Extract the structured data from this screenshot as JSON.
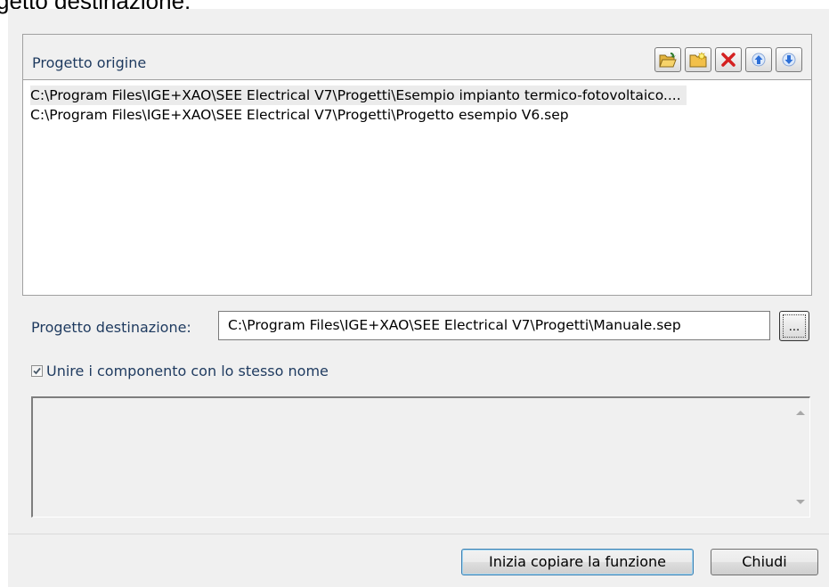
{
  "caption_fragment": "getto destinazione:",
  "source": {
    "title": "Progetto origine",
    "toolbar": [
      {
        "name": "open-folder-icon",
        "label": "open"
      },
      {
        "name": "new-folder-icon",
        "label": "add"
      },
      {
        "name": "delete-icon",
        "label": "delete"
      },
      {
        "name": "move-up-icon",
        "label": "up"
      },
      {
        "name": "move-down-icon",
        "label": "down"
      }
    ],
    "items": [
      "C:\\Program Files\\IGE+XAO\\SEE Electrical V7\\Progetti\\Esempio impianto termico-fotovoltaico....",
      "C:\\Program Files\\IGE+XAO\\SEE Electrical V7\\Progetti\\Progetto esempio V6.sep"
    ],
    "selected_index": 0
  },
  "destination": {
    "label": "Progetto destinazione:",
    "value": "C:\\Program Files\\IGE+XAO\\SEE Electrical V7\\Progetti\\Manuale.sep",
    "browse_label": "..."
  },
  "merge": {
    "label": "Unire i componento con lo stesso nome",
    "checked": true
  },
  "buttons": {
    "start": "Inizia copiare la funzione",
    "close": "Chiudi"
  },
  "colors": {
    "dialog_bg": "#f0f0f0",
    "label_text": "#1e3a5f",
    "delete_red": "#d42020",
    "arrow_blue": "#2d6fd6",
    "folder_yellow": "#f2c04a"
  }
}
